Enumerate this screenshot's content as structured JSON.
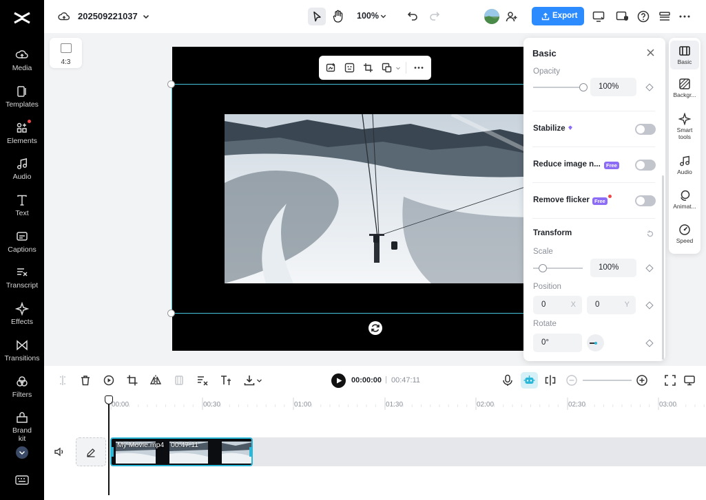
{
  "app": {
    "project_name": "202509221037",
    "zoom": "100%",
    "export_label": "Export"
  },
  "leftnav": [
    {
      "label": "Media",
      "icon": "cloud-upload-icon"
    },
    {
      "label": "Templates",
      "icon": "templates-icon"
    },
    {
      "label": "Elements",
      "icon": "elements-icon"
    },
    {
      "label": "Audio",
      "icon": "music-note-icon"
    },
    {
      "label": "Text",
      "icon": "text-icon"
    },
    {
      "label": "Captions",
      "icon": "captions-icon"
    },
    {
      "label": "Transcript",
      "icon": "transcript-icon"
    },
    {
      "label": "Effects",
      "icon": "effects-icon"
    },
    {
      "label": "Transitions",
      "icon": "transitions-icon"
    },
    {
      "label": "Filters",
      "icon": "filters-icon"
    },
    {
      "label": "Brand kit",
      "icon": "brand-kit-icon"
    }
  ],
  "canvas": {
    "aspect_ratio": "4:3"
  },
  "panel": {
    "title": "Basic",
    "opacity_label": "Opacity",
    "opacity_value": "100%",
    "opacity_level": 1.0,
    "stabilize_label": "Stabilize",
    "reduce_noise_label": "Reduce image n...",
    "remove_flicker_label": "Remove flicker",
    "free_badge": "Free",
    "transform_label": "Transform",
    "scale_label": "Scale",
    "scale_value": "100%",
    "position_label": "Position",
    "position_x": "0",
    "position_x_suffix": "X",
    "position_y": "0",
    "position_y_suffix": "Y",
    "rotate_label": "Rotate",
    "rotate_value": "0°"
  },
  "righttools": [
    {
      "label": "Basic",
      "icon": "basic-icon",
      "active": true
    },
    {
      "label": "Backgr...",
      "icon": "background-icon"
    },
    {
      "label": "Smart tools",
      "icon": "smart-tools-icon"
    },
    {
      "label": "Audio",
      "icon": "audio-icon"
    },
    {
      "label": "Animat...",
      "icon": "animation-icon"
    },
    {
      "label": "Speed",
      "icon": "speed-icon"
    }
  ],
  "playback": {
    "current_time": "00:00:00",
    "separator": "|",
    "total_time": "00:47:11"
  },
  "ruler": [
    "00:00",
    "00:30",
    "01:00",
    "01:30",
    "02:00",
    "02:30",
    "03:00"
  ],
  "clip": {
    "name": "My Movie.mp4",
    "duration": "00:47:11"
  },
  "colors": {
    "accent": "#2c8cff",
    "selection": "#48c6e0",
    "free_badge": "#8d6cf5"
  }
}
